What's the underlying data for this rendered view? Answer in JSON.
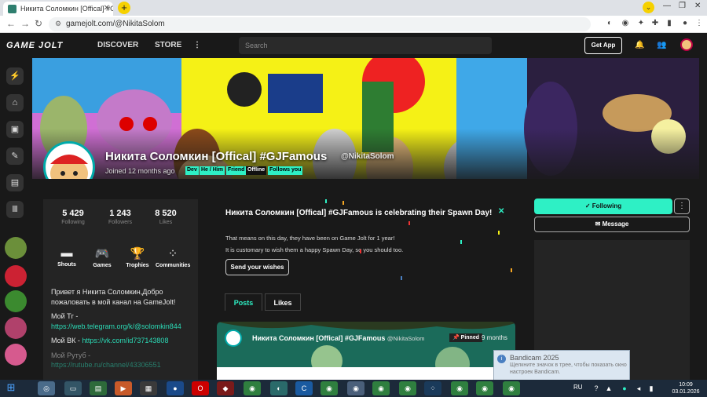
{
  "browser": {
    "tab_title": "Никита Соломкин [Offical] #GJ...",
    "url": "gamejolt.com/@NikitaSolom"
  },
  "gj_nav": {
    "logo": "GAME JOLT",
    "discover": "DISCOVER",
    "store": "STORE",
    "search_placeholder": "Search",
    "get_app": "Get App"
  },
  "profile": {
    "name": "Никита Соломкин [Offical] #GJFamous",
    "handle": "@NikitaSolom",
    "joined": "Joined 12 months ago",
    "tags": [
      "Dev",
      "He / Him",
      "Friend",
      "Offline",
      "Follows you"
    ],
    "tag_colors": [
      "#2ef0c5",
      "#2ef0c5",
      "#2ef0c5",
      "#111111",
      "#2ef0c5"
    ],
    "stats": [
      {
        "value": "5 429",
        "label": "Following"
      },
      {
        "value": "1 243",
        "label": "Followers"
      },
      {
        "value": "8 520",
        "label": "Likes"
      }
    ],
    "shortcuts": [
      {
        "label": "Shouts",
        "icon": "shouts-icon"
      },
      {
        "label": "Games",
        "icon": "gamepad-icon"
      },
      {
        "label": "Trophies",
        "icon": "trophy-icon"
      },
      {
        "label": "Communities",
        "icon": "communities-icon"
      }
    ],
    "bio": {
      "intro": "Привет я Никита Соломкин,Добро пожаловать в мой канал на GameJolt!",
      "tg_label": "Мой Тг -",
      "tg_link": "https://web.telegram.org/k/@solomkin844",
      "vk_label": "Мой ВК - ",
      "vk_link": "https://vk.com/id737143808",
      "rutube_label": "Мой Рутуб -",
      "rutube_link": "https://rutube.ru/channel/43306551"
    }
  },
  "spawn": {
    "title": "Никита Соломкин [Offical] #GJFamous is celebrating their Spawn Day!",
    "p1": "That means on this day, they have been on Game Jolt for 1 year!",
    "p2": "It is customary to wish them a happy Spawn Day, so you should too.",
    "button": "Send your wishes"
  },
  "tabs": {
    "posts": "Posts",
    "likes": "Likes"
  },
  "post": {
    "author": "Никита Соломкин [Offical] #GJFamous",
    "handle": "@NikitaSolom",
    "pinned": "Pinned",
    "time": "9 months"
  },
  "actions": {
    "following": "Following",
    "message": "Message"
  },
  "toast": {
    "title": "Bandicam 2025",
    "body": "Щелкните значок в трее, чтобы показать окно настроек Bandicam."
  },
  "taskbar": {
    "lang": "RU",
    "time": "10:09",
    "date": "03.01.2026"
  },
  "colors": {
    "accent": "#2ef0c5",
    "page_bg": "#191919",
    "card_bg": "#242424"
  }
}
